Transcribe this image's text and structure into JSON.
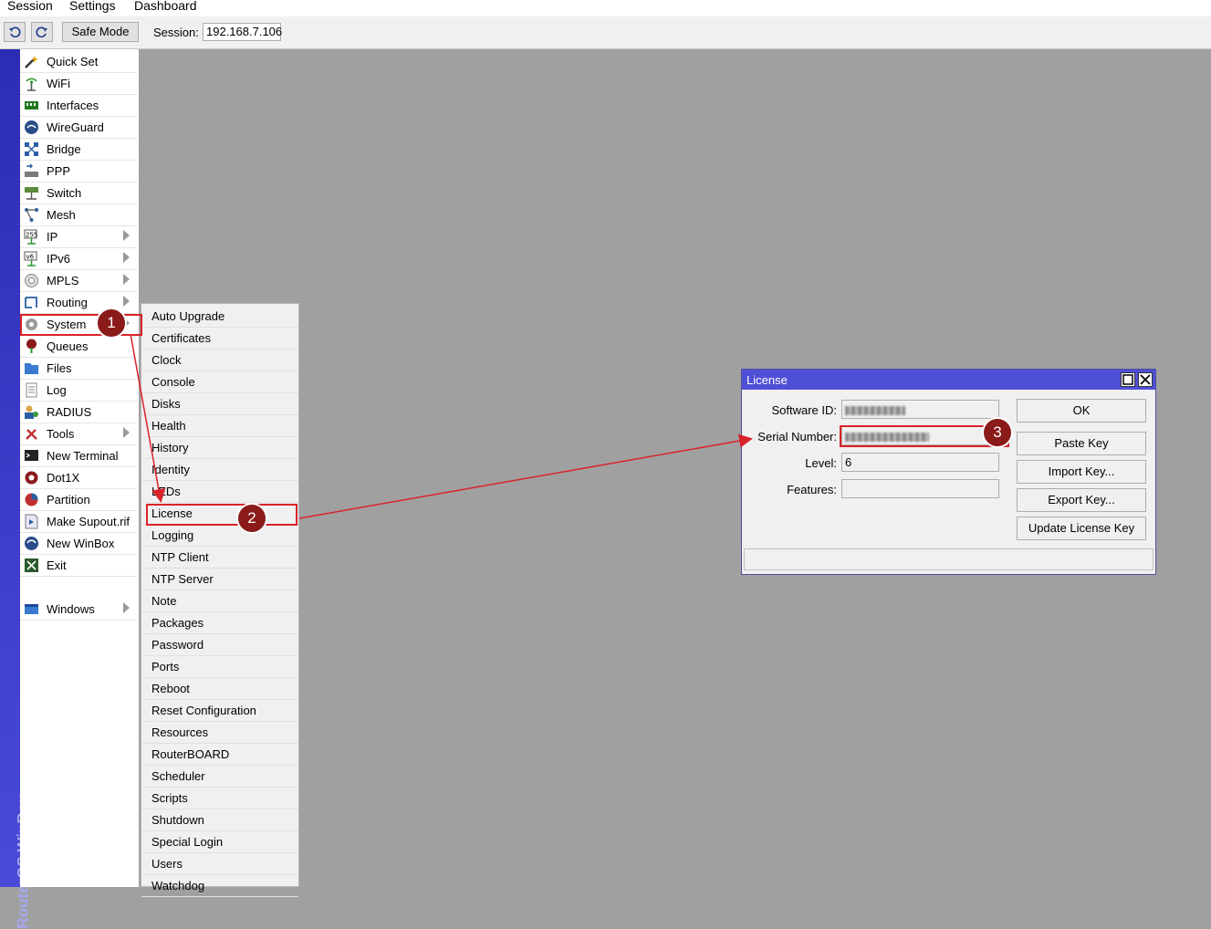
{
  "menubar": {
    "items": [
      "Session",
      "Settings",
      "Dashboard"
    ]
  },
  "toolbar": {
    "undo_icon": "undo-icon",
    "redo_icon": "redo-icon",
    "safe_mode_label": "Safe Mode",
    "session_label": "Session:",
    "session_value": "192.168.7.106"
  },
  "branding": {
    "vertical_text": "RouterOS WinBox"
  },
  "sidebar": {
    "items": [
      {
        "label": "Quick Set",
        "icon": "magic-wand-icon",
        "submenu": false
      },
      {
        "label": "WiFi",
        "icon": "wifi-antenna-icon",
        "submenu": false
      },
      {
        "label": "Interfaces",
        "icon": "interfaces-icon",
        "submenu": false
      },
      {
        "label": "WireGuard",
        "icon": "wireguard-icon",
        "submenu": false
      },
      {
        "label": "Bridge",
        "icon": "bridge-icon",
        "submenu": false
      },
      {
        "label": "PPP",
        "icon": "ppp-icon",
        "submenu": false
      },
      {
        "label": "Switch",
        "icon": "switch-icon",
        "submenu": false
      },
      {
        "label": "Mesh",
        "icon": "mesh-icon",
        "submenu": false
      },
      {
        "label": "IP",
        "icon": "ip-icon",
        "submenu": true
      },
      {
        "label": "IPv6",
        "icon": "ipv6-icon",
        "submenu": true
      },
      {
        "label": "MPLS",
        "icon": "mpls-icon",
        "submenu": true
      },
      {
        "label": "Routing",
        "icon": "routing-icon",
        "submenu": true
      },
      {
        "label": "System",
        "icon": "gear-icon",
        "submenu": true
      },
      {
        "label": "Queues",
        "icon": "queues-icon",
        "submenu": false
      },
      {
        "label": "Files",
        "icon": "folder-icon",
        "submenu": false
      },
      {
        "label": "Log",
        "icon": "log-icon",
        "submenu": false
      },
      {
        "label": "RADIUS",
        "icon": "radius-icon",
        "submenu": false
      },
      {
        "label": "Tools",
        "icon": "tools-icon",
        "submenu": true
      },
      {
        "label": "New Terminal",
        "icon": "terminal-icon",
        "submenu": false
      },
      {
        "label": "Dot1X",
        "icon": "dot1x-icon",
        "submenu": false
      },
      {
        "label": "Partition",
        "icon": "partition-icon",
        "submenu": false
      },
      {
        "label": "Make Supout.rif",
        "icon": "supout-icon",
        "submenu": false
      },
      {
        "label": "New WinBox",
        "icon": "winbox-icon",
        "submenu": false
      },
      {
        "label": "Exit",
        "icon": "exit-icon",
        "submenu": false
      }
    ],
    "windows_item": {
      "label": "Windows",
      "icon": "windows-icon",
      "submenu": true
    }
  },
  "system_submenu": {
    "items": [
      "Auto Upgrade",
      "Certificates",
      "Clock",
      "Console",
      "Disks",
      "Health",
      "History",
      "Identity",
      "LEDs",
      "License",
      "Logging",
      "NTP Client",
      "NTP Server",
      "Note",
      "Packages",
      "Password",
      "Ports",
      "Reboot",
      "Reset Configuration",
      "Resources",
      "RouterBOARD",
      "Scheduler",
      "Scripts",
      "Shutdown",
      "Special Login",
      "Users",
      "Watchdog"
    ]
  },
  "license_window": {
    "title": "License",
    "fields": [
      {
        "label": "Software ID:",
        "value": ""
      },
      {
        "label": "Serial Number:",
        "value": ""
      },
      {
        "label": "Level:",
        "value": "6"
      },
      {
        "label": "Features:",
        "value": ""
      }
    ],
    "buttons": [
      "OK",
      "Paste Key",
      "Import Key...",
      "Export Key...",
      "Update License Key"
    ],
    "status_text": ""
  },
  "annotations": {
    "badges": [
      "1",
      "2",
      "3"
    ],
    "color": "#d9232a"
  },
  "colors": {
    "title_bar": "#4f4fd6",
    "vertical_bar": "#2c2cb6",
    "desktop": "#a0a0a0"
  }
}
